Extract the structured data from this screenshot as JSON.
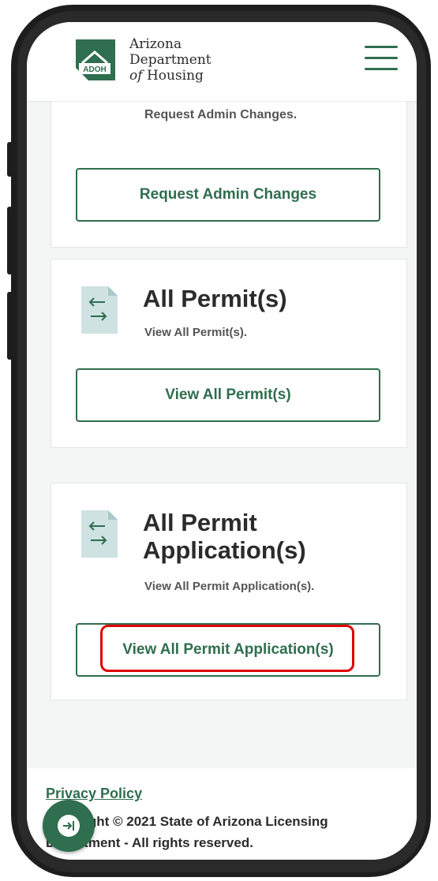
{
  "header": {
    "logo_abbr": "ADOH",
    "logo_line1": "Arizona",
    "logo_line2": "Department",
    "logo_line3_prefix": "of",
    "logo_line3_suffix": "Housing",
    "menu_icon": "hamburger-menu-icon"
  },
  "cards": [
    {
      "description": "Request Admin Changes.",
      "button_label": "Request Admin Changes"
    },
    {
      "icon": "document-swap-icon",
      "title": "All Permit(s)",
      "description": "View All Permit(s).",
      "button_label": "View All Permit(s)"
    },
    {
      "icon": "document-swap-icon",
      "title_line1": "All Permit",
      "title_line2": "Application(s)",
      "description": "View All Permit Application(s).",
      "button_label": "View All Permit Application(s)"
    }
  ],
  "footer": {
    "privacy_label": "Privacy Policy",
    "copyright_line1": "Copyright © 2021 State of Arizona Licensing",
    "copyright_line2": "Department - All rights reserved.",
    "fab_icon": "arrow-right-to-bar-icon"
  },
  "colors": {
    "brand_green": "#2f6e4e",
    "highlight_red": "#e00000",
    "icon_teal": "#cfe2e2"
  }
}
